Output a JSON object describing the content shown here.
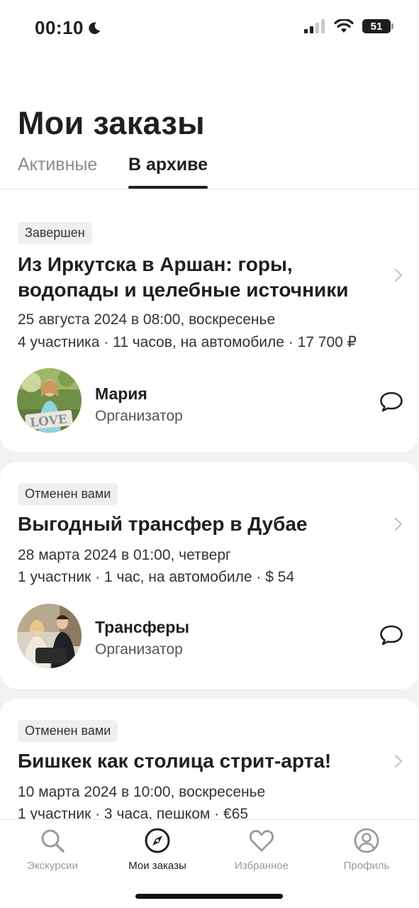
{
  "status_bar": {
    "time": "00:10",
    "battery": "51"
  },
  "header": {
    "title": "Мои заказы"
  },
  "tabs": [
    {
      "label": "Активные",
      "active": false
    },
    {
      "label": "В архиве",
      "active": true
    }
  ],
  "orders": [
    {
      "status": "Завершен",
      "title": "Из Иркутска в Аршан: горы, водопады и целебные источники",
      "date": "25 августа 2024 в 08:00, воскресенье",
      "details": "4 участника · 11 часов, на автомобиле · 17 700 ₽",
      "organizer": {
        "name": "Мария",
        "role": "Организатор"
      }
    },
    {
      "status": "Отменен вами",
      "title": "Выгодный трансфер в Дубае",
      "date": "28 марта 2024 в 01:00, четверг",
      "details": "1 участник · 1 час, на автомобиле · $ 54",
      "organizer": {
        "name": "Трансферы",
        "role": "Организатор"
      }
    },
    {
      "status": "Отменен вами",
      "title": "Бишкек как столица стрит-арта!",
      "date": "10 марта 2024 в 10:00, воскресенье",
      "details": "1 участник · 3 часа, пешком · €65"
    }
  ],
  "bottom_nav": [
    {
      "label": "Экскурсии",
      "icon": "search-icon",
      "active": false
    },
    {
      "label": "Мои заказы",
      "icon": "compass-icon",
      "active": true
    },
    {
      "label": "Избранное",
      "icon": "heart-icon",
      "active": false
    },
    {
      "label": "Профиль",
      "icon": "profile-icon",
      "active": false
    }
  ],
  "colors": {
    "accent": "#1f1f1f",
    "muted": "#9a9a9a",
    "background": "#f2f2f2",
    "badge": "#efefef"
  }
}
